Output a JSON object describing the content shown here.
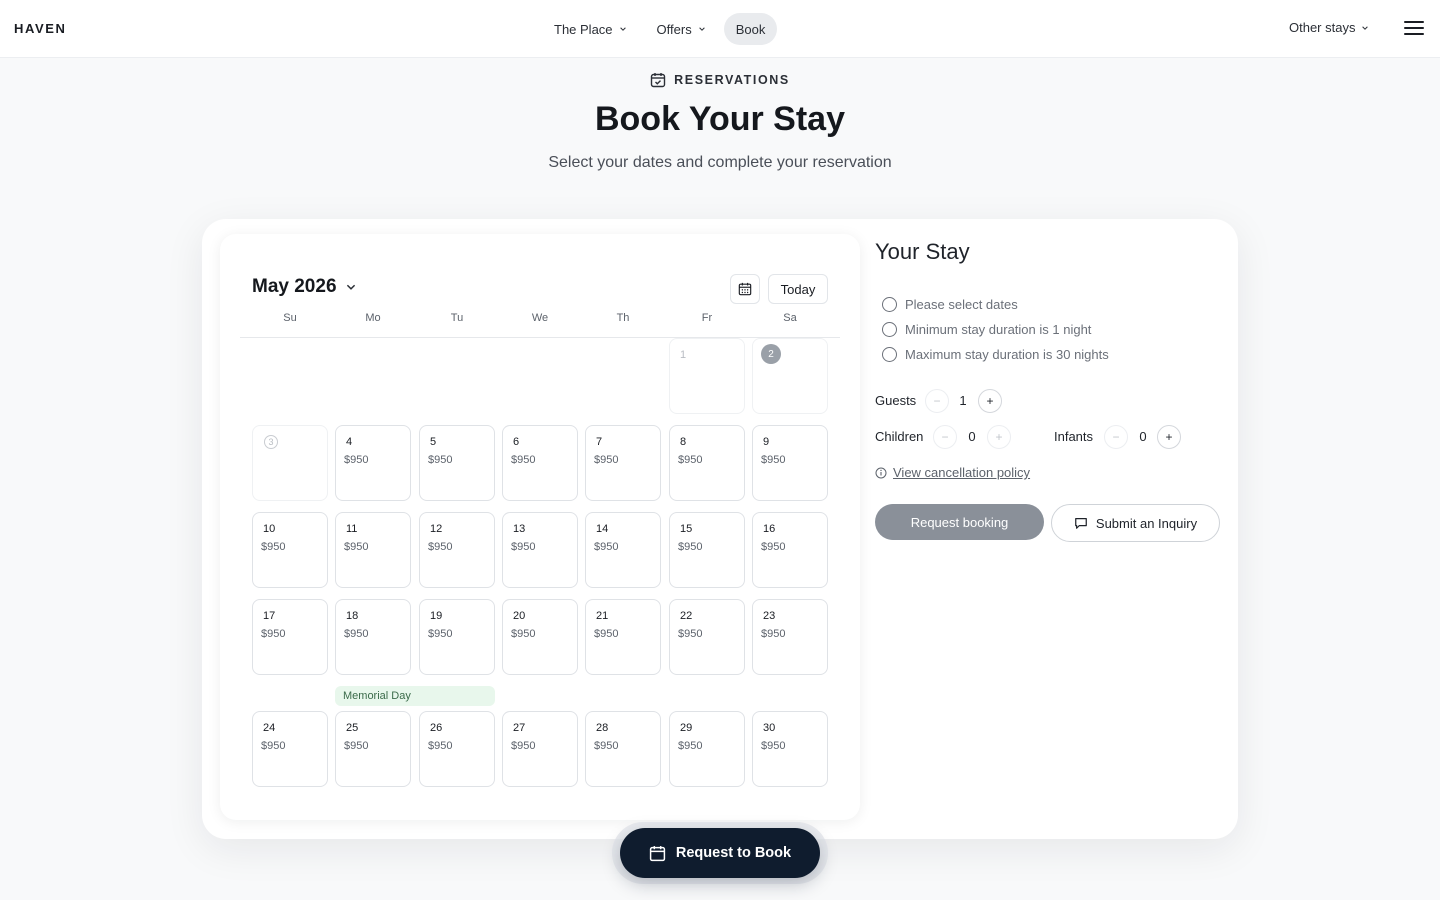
{
  "header": {
    "logo": "HAVEN",
    "nav": [
      {
        "label": "The Place",
        "has_dropdown": true,
        "active": false
      },
      {
        "label": "Offers",
        "has_dropdown": true,
        "active": false
      },
      {
        "label": "Book",
        "has_dropdown": false,
        "active": true
      }
    ],
    "other_stays": "Other stays",
    "menu_icon": "hamburger-icon"
  },
  "hero": {
    "eyebrow": "RESERVATIONS",
    "eyebrow_icon": "calendar-check-icon",
    "title": "Book Your Stay",
    "subtitle": "Select your dates and complete your reservation"
  },
  "calendar": {
    "month_label": "May 2026",
    "today_label": "Today",
    "calendar_icon": "calendar-icon",
    "weekdays": [
      "Su",
      "Mo",
      "Tu",
      "We",
      "Th",
      "Fr",
      "Sa"
    ],
    "past_days": [
      {
        "num": "1",
        "style": "plain",
        "col": 5,
        "row": 0
      },
      {
        "num": "2",
        "style": "circled",
        "col": 6,
        "row": 0
      },
      {
        "num": "3",
        "style": "ring",
        "col": 0,
        "row": 1
      }
    ],
    "weeks": [
      {
        "row": 1,
        "days": [
          null,
          {
            "num": "4",
            "price": "$950"
          },
          {
            "num": "5",
            "price": "$950"
          },
          {
            "num": "6",
            "price": "$950"
          },
          {
            "num": "7",
            "price": "$950"
          },
          {
            "num": "8",
            "price": "$950"
          },
          {
            "num": "9",
            "price": "$950"
          }
        ]
      },
      {
        "row": 2,
        "days": [
          {
            "num": "10",
            "price": "$950"
          },
          {
            "num": "11",
            "price": "$950"
          },
          {
            "num": "12",
            "price": "$950"
          },
          {
            "num": "13",
            "price": "$950"
          },
          {
            "num": "14",
            "price": "$950"
          },
          {
            "num": "15",
            "price": "$950"
          },
          {
            "num": "16",
            "price": "$950"
          }
        ]
      },
      {
        "row": 3,
        "days": [
          {
            "num": "17",
            "price": "$950"
          },
          {
            "num": "18",
            "price": "$950"
          },
          {
            "num": "19",
            "price": "$950"
          },
          {
            "num": "20",
            "price": "$950"
          },
          {
            "num": "21",
            "price": "$950"
          },
          {
            "num": "22",
            "price": "$950"
          },
          {
            "num": "23",
            "price": "$950"
          }
        ]
      },
      {
        "row": 4,
        "days": [
          {
            "num": "24",
            "price": "$950"
          },
          {
            "num": "25",
            "price": "$950"
          },
          {
            "num": "26",
            "price": "$950"
          },
          {
            "num": "27",
            "price": "$950"
          },
          {
            "num": "28",
            "price": "$950"
          },
          {
            "num": "29",
            "price": "$950"
          },
          {
            "num": "30",
            "price": "$950"
          }
        ]
      }
    ],
    "holiday": "Memorial Day"
  },
  "stay": {
    "title": "Your Stay",
    "requirements": [
      "Please select dates",
      "Minimum stay duration is 1 night",
      "Maximum stay duration is 30 nights"
    ],
    "guests": {
      "label": "Guests",
      "value": "1"
    },
    "children": {
      "label": "Children",
      "value": "0"
    },
    "infants": {
      "label": "Infants",
      "value": "0"
    },
    "policy_link": "View cancellation policy",
    "request_booking": "Request booking",
    "inquiry": "Submit an Inquiry"
  },
  "floating": {
    "label": "Request to Book"
  },
  "colors": {
    "primary_dark": "#0f1c2e",
    "disabled_btn": "#8a9099",
    "holiday_bg": "#e8f7ec"
  }
}
